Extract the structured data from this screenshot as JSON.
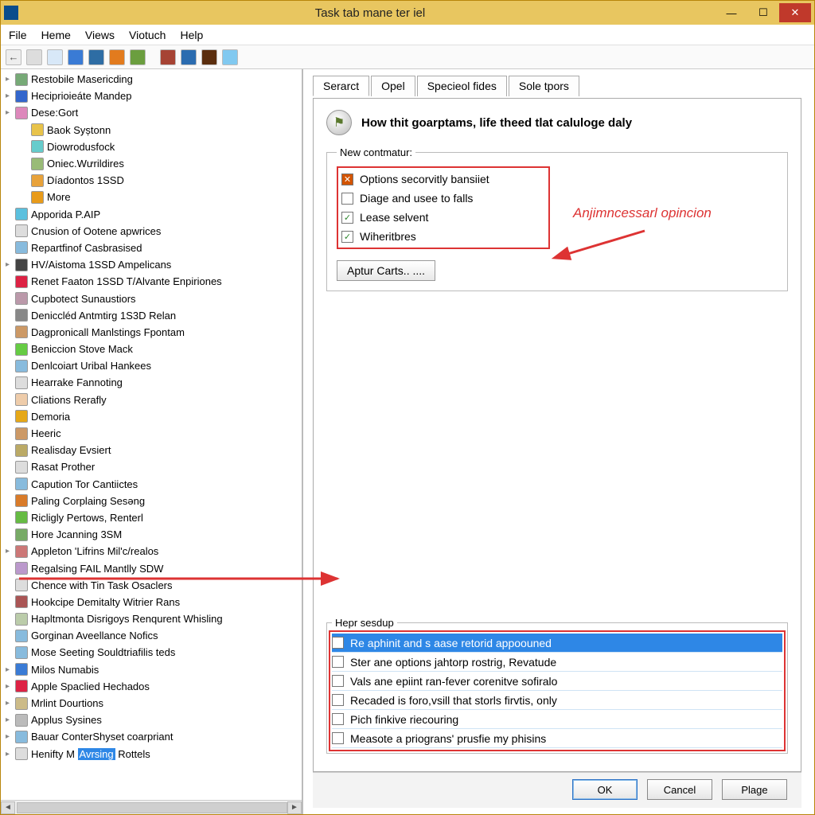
{
  "title": "Task tab mane ter iel",
  "menu": {
    "file": "File",
    "heme": "Heme",
    "views": "Views",
    "viotuch": "Viotuch",
    "help": "Help"
  },
  "tree": [
    {
      "label": "Restobile Masericding",
      "exp": true,
      "c": "#7a7",
      "child": false
    },
    {
      "label": "Heciprioieáte Mandep",
      "exp": true,
      "c": "#36c",
      "child": false
    },
    {
      "label": "Dese:Gort",
      "exp": true,
      "c": "#d8b",
      "child": false
    },
    {
      "label": "Baok Syștonn",
      "exp": true,
      "c": "#e8c34a",
      "child": true
    },
    {
      "label": "Diowrodusfock",
      "exp": true,
      "c": "#6cc",
      "child": true
    },
    {
      "label": "Oniec.Wưrildires",
      "exp": true,
      "c": "#9b7",
      "child": true
    },
    {
      "label": "Díadontos 1SSD",
      "exp": true,
      "c": "#e8a23a",
      "child": true
    },
    {
      "label": "More",
      "exp": true,
      "c": "#e89b1a",
      "child": true
    },
    {
      "label": "Apporida P.AIP",
      "exp": false,
      "c": "#5bc0de",
      "child": false
    },
    {
      "label": "Cnusion of Ootene apwrices",
      "exp": false,
      "c": "#ddd",
      "child": false
    },
    {
      "label": "Repartfinof Casbrasised",
      "exp": false,
      "c": "#8bd",
      "child": false
    },
    {
      "label": "HV/Aistoma 1SSD Ampelicans",
      "exp": true,
      "c": "#444",
      "child": false
    },
    {
      "label": "Renet Faaton 1SSD T/Alvante Enpiriones",
      "exp": false,
      "c": "#d24",
      "child": false
    },
    {
      "label": "Cupbotect Sunaustiors",
      "exp": false,
      "c": "#b9a",
      "child": false
    },
    {
      "label": "Deniccléd Antmtirg 1S3D Relan",
      "exp": false,
      "c": "#888",
      "child": false
    },
    {
      "label": "Dagpronicall Manlstings Fpontam",
      "exp": false,
      "c": "#c96",
      "child": false
    },
    {
      "label": "Beniccion Stove Mack",
      "exp": false,
      "c": "#6c4",
      "child": false
    },
    {
      "label": "Denlcoiart Uribal Hankees",
      "exp": false,
      "c": "#8bd",
      "child": false
    },
    {
      "label": "Hearrake Fannoting",
      "exp": false,
      "c": "#ddd",
      "child": false
    },
    {
      "label": "Cliations Rerafly",
      "exp": false,
      "c": "#eca",
      "child": false
    },
    {
      "label": "Demoria",
      "exp": false,
      "c": "#e6a817",
      "child": false
    },
    {
      "label": "Heeric",
      "exp": false,
      "c": "#c96",
      "child": false
    },
    {
      "label": "Realisday Evsiert",
      "exp": false,
      "c": "#ba6",
      "child": false
    },
    {
      "label": "Rasat Prother",
      "exp": false,
      "c": "#ddd",
      "child": false
    },
    {
      "label": "Capution Tor Cantiictes",
      "exp": false,
      "c": "#8bd",
      "child": false
    },
    {
      "label": "Paling Corplaing Sesəng",
      "exp": false,
      "c": "#d97b29",
      "child": false
    },
    {
      "label": "Ricligly Pertows, Renterl",
      "exp": false,
      "c": "#6b4",
      "child": false
    },
    {
      "label": "Hore Jcanning 3SM",
      "exp": false,
      "c": "#7a6",
      "child": false
    },
    {
      "label": "Appleton 'Lifrins Mil'c/realos",
      "exp": true,
      "c": "#c77",
      "child": false,
      "hasArrow": true
    },
    {
      "label": "Regalsing FAIL Mantlly SDW",
      "exp": false,
      "c": "#b9c",
      "child": false
    },
    {
      "label": "Chence with Tin Task Osaclers",
      "exp": false,
      "c": "#ddd",
      "child": false
    },
    {
      "label": "Hookcipe Demitalty Witrier Rans",
      "exp": false,
      "c": "#a55",
      "child": false
    },
    {
      "label": "Hapltmonta Disrigoys Renqurent Whisling",
      "exp": false,
      "c": "#bca",
      "child": false
    },
    {
      "label": "Gorginan Aveellance Nofics",
      "exp": false,
      "c": "#8bd",
      "child": false
    },
    {
      "label": "Mose Seeting Souldtriafilis teds",
      "exp": false,
      "c": "#8bd",
      "child": false
    },
    {
      "label": "Milos Numabis",
      "exp": true,
      "c": "#3a7bd5",
      "child": false
    },
    {
      "label": "Apple Spaclied Hechados",
      "exp": true,
      "c": "#d24",
      "child": false
    },
    {
      "label": "Mrlint Dourtions",
      "exp": true,
      "c": "#cb8",
      "child": false
    },
    {
      "label": "Applus Sysines",
      "exp": true,
      "c": "#bbb",
      "child": false
    },
    {
      "label": "Bauar ConterShyset coarpriant",
      "exp": true,
      "c": "#8bd",
      "child": false
    },
    {
      "label": "Henifty M",
      "exp": true,
      "c": "#ddd",
      "child": false,
      "suffix": " Rottels",
      "hl": "Avrsing"
    }
  ],
  "tabs": {
    "t0": "Serarct",
    "t1": "Opel",
    "t2": "Specieol fides",
    "t3": "Sole tpors"
  },
  "heading": "How thit goarptams, life theed tlat caluloge daly",
  "fieldset1_legend": "New contmatur:",
  "opts1": [
    {
      "label": "Options secorvitly bansiiet",
      "state": "x"
    },
    {
      "label": "Diage and usee to falls",
      "state": ""
    },
    {
      "label": "Lease selvent",
      "state": "✓"
    },
    {
      "label": "Wiheritbres",
      "state": "✓"
    }
  ],
  "annotation": "Anjimncessarl opincion",
  "button1": "Aptur Carts.. ....",
  "fieldset2_legend": "Hepr sesdup",
  "opts2": [
    {
      "label": "Re aphinit and s aase retorid appoouned",
      "sel": true
    },
    {
      "label": "Ster ane options jahtorp rostrig, Revatude"
    },
    {
      "label": "Vals ane epiint ran-fever corenitve sofiralo"
    },
    {
      "label": "Recaded is foro,vsill that storls firvtis, only"
    },
    {
      "label": "Pich finkive riecouring"
    },
    {
      "label": "Measote a priograns' prusfie my phisins"
    }
  ],
  "footer": {
    "ok": "OK",
    "cancel": "Cancel",
    "plage": "Plage"
  }
}
